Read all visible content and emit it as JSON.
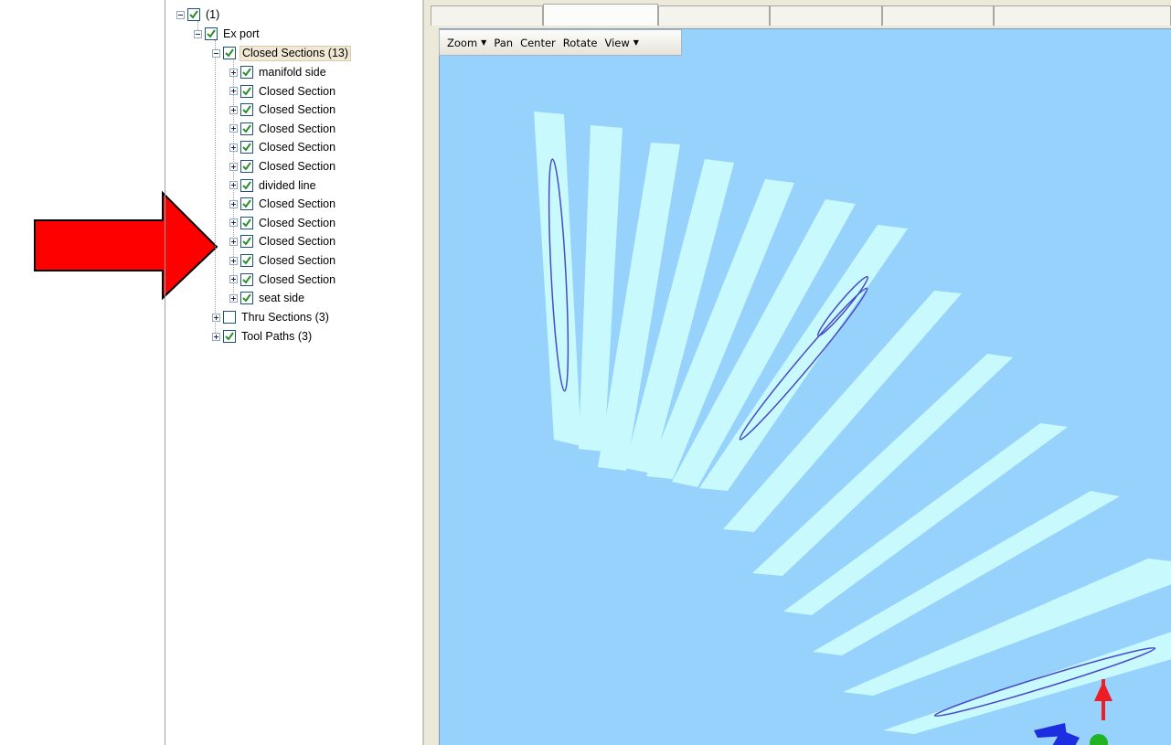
{
  "colors": {
    "annotation_arrow": "#ff0000",
    "viewport_bg": "#96d2fb",
    "section_fill": "#c8fafd",
    "curve_stroke": "#4a4ac8",
    "check_mark": "#2a8f2a"
  },
  "tree": {
    "root": {
      "label": "(1)",
      "checked": true,
      "expanded": true
    },
    "export": {
      "label": "Ex port",
      "checked": true,
      "expanded": true
    },
    "closed_sections": {
      "label": "Closed Sections (13)",
      "checked": true,
      "expanded": true,
      "selected": true
    },
    "closed_items": [
      {
        "label": "manifold side",
        "checked": true
      },
      {
        "label": "Closed Section",
        "checked": true
      },
      {
        "label": "Closed Section",
        "checked": true
      },
      {
        "label": "Closed Section",
        "checked": true
      },
      {
        "label": "Closed Section",
        "checked": true
      },
      {
        "label": "Closed Section",
        "checked": true
      },
      {
        "label": "divided line",
        "checked": true
      },
      {
        "label": "Closed Section",
        "checked": true
      },
      {
        "label": "Closed Section",
        "checked": true
      },
      {
        "label": "Closed Section",
        "checked": true
      },
      {
        "label": "Closed Section",
        "checked": true
      },
      {
        "label": "Closed Section",
        "checked": true
      },
      {
        "label": "seat side",
        "checked": true
      }
    ],
    "thru_sections": {
      "label": "Thru Sections (3)",
      "checked": false
    },
    "tool_paths": {
      "label": "Tool Paths (3)",
      "checked": true
    }
  },
  "toolbar": {
    "zoom": "Zoom",
    "pan": "Pan",
    "center": "Center",
    "rotate": "Rotate",
    "view": "View",
    "dropdown_icon": "caret-down-icon"
  },
  "axis_gizmo": {
    "icon": "xyz-axis-icon"
  }
}
